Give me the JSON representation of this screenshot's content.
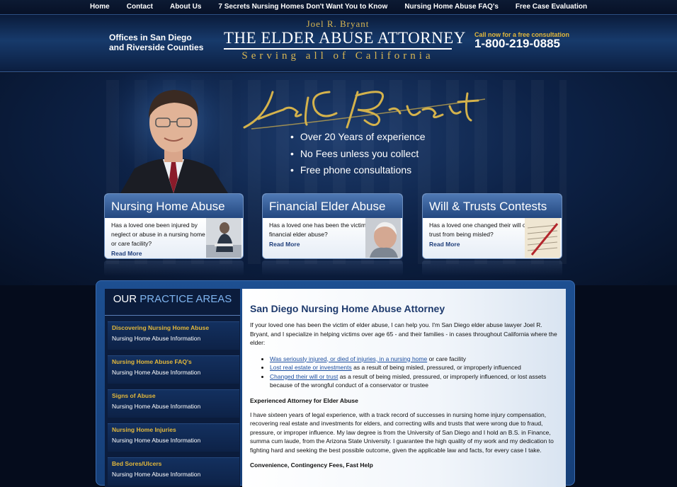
{
  "topnav": {
    "items": [
      "Home",
      "Contact",
      "About Us",
      "7 Secrets Nursing Homes Don't Want You to Know",
      "Nursing Home Abuse FAQ's",
      "Free Case Evaluation"
    ]
  },
  "header": {
    "offices_line1": "Offices in San Diego",
    "offices_line2": "and Riverside Counties",
    "attorney_name": "Joel R. Bryant",
    "firm_name": "THE ELDER ABUSE ATTORNEY",
    "tagline": "Serving all of California",
    "call_now": "Call now for a free consultation",
    "phone": "1-800-219-0885"
  },
  "hero": {
    "signature": "Joel R. Bryant",
    "bullets": [
      "Over 20 Years of experience",
      "No Fees unless you collect",
      "Free phone consultations"
    ]
  },
  "cards": [
    {
      "title": "Nursing Home Abuse",
      "text": "Has a loved one been injured by neglect or abuse in a nursing home or care facility?",
      "link": "Read More"
    },
    {
      "title": "Financial Elder Abuse",
      "text": "Has a loved one has been the victim of financial elder abuse?",
      "link": "Read More"
    },
    {
      "title": "Will & Trusts Contests",
      "text": "Has a loved one changed their will or trust from being misled?",
      "link": "Read More"
    }
  ],
  "sidebar": {
    "title_plain": "OUR",
    "title_accent": "PRACTICE AREAS",
    "items": [
      {
        "title": "Discovering Nursing Home Abuse",
        "sub": "Nursing Home Abuse Information"
      },
      {
        "title": "Nursing Home Abuse FAQ's",
        "sub": "Nursing Home Abuse Information"
      },
      {
        "title": "Signs of Abuse",
        "sub": "Nursing Home Abuse Information"
      },
      {
        "title": "Nursing Home Injuries",
        "sub": "Nursing Home Abuse Information"
      },
      {
        "title": "Bed Sores/Ulcers",
        "sub": "Nursing Home Abuse Information"
      }
    ]
  },
  "content": {
    "heading": "San Diego Nursing Home Abuse Attorney",
    "intro": "If your loved one has been the victim of elder abuse, I can help you. I'm San Diego elder abuse lawyer Joel R. Bryant, and I specialize in helping victims over age 65 - and their families - in cases throughout California where the elder:",
    "list": [
      {
        "link": "Was seriously injured, or died of injuries, in a nursing home",
        "rest": " or care facility"
      },
      {
        "link": "Lost real estate or investments",
        "rest": " as a result of being misled, pressured, or improperly influenced"
      },
      {
        "link": "Changed their will or trust",
        "rest": " as a result of being misled, pressured, or improperly influenced, or lost assets because of the wrongful conduct of a conservator or trustee"
      }
    ],
    "subheading1": "Experienced Attorney for Elder Abuse",
    "paragraph1": "I have sixteen years of legal experience, with a track record of successes in nursing home injury compensation, recovering real estate and investments for elders, and correcting wills and trusts that were wrong due to fraud, pressure, or improper influence. My law degree is from the University of San Diego and I hold an B.S. in Finance, summa cum laude, from the Arizona State University. I guarantee the high quality of my work and my dedication to fighting hard and seeking the best possible outcome, given the applicable law and facts, for every case I take.",
    "subheading2": "Convenience, Contingency Fees, Fast Help"
  }
}
